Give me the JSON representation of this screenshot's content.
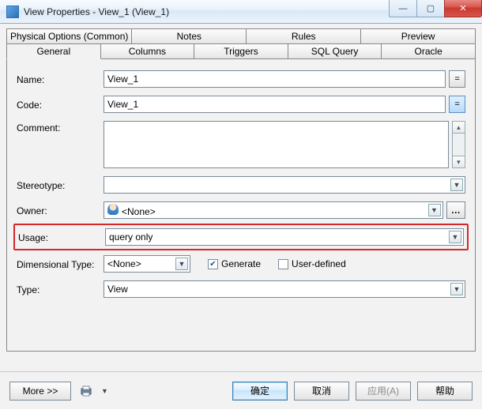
{
  "window": {
    "title": "View Properties - View_1 (View_1)"
  },
  "tabs": {
    "row1": [
      "Physical Options (Common)",
      "Notes",
      "Rules",
      "Preview"
    ],
    "row2": [
      "General",
      "Columns",
      "Triggers",
      "SQL Query",
      "Oracle"
    ]
  },
  "form": {
    "name_label": "Name:",
    "name_value": "View_1",
    "code_label": "Code:",
    "code_value": "View_1",
    "comment_label": "Comment:",
    "comment_value": "",
    "stereotype_label": "Stereotype:",
    "stereotype_value": "",
    "owner_label": "Owner:",
    "owner_value": "<None>",
    "usage_label": "Usage:",
    "usage_value": "query only",
    "dimtype_label": "Dimensional Type:",
    "dimtype_value": "<None>",
    "generate_label": "Generate",
    "userdef_label": "User-defined",
    "type_label": "Type:",
    "type_value": "View"
  },
  "footer": {
    "more": "More >>",
    "ok": "确定",
    "cancel": "取消",
    "apply": "应用(A)",
    "help": "帮助"
  }
}
